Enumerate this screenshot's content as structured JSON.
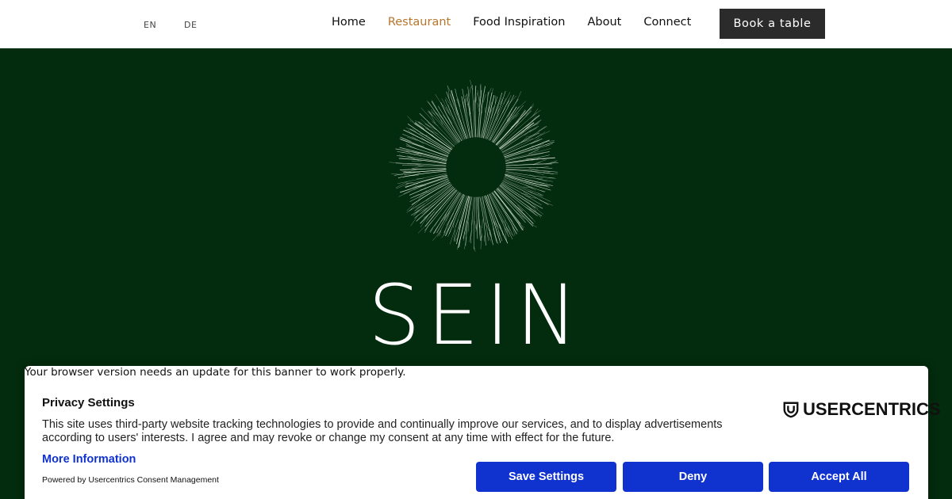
{
  "header": {
    "languages": [
      "EN",
      "DE"
    ],
    "nav": [
      "Home",
      "Restaurant",
      "Food Inspiration",
      "About",
      "Connect"
    ],
    "active_nav": "Restaurant",
    "book_label": "Book a table"
  },
  "hero": {
    "brand": "SEIN",
    "background": "#032b0d"
  },
  "consent": {
    "warning": "Your browser version needs an update for this banner to work properly.",
    "title": "Privacy Settings",
    "description": "This site uses third-party website tracking technologies to provide and continually improve our services, and to display advertisements according to users' interests. I agree and may revoke or change my consent at any time with effect for the future.",
    "more_info": "More Information",
    "powered_by": "Powered by Usercentrics Consent Management",
    "logo_text": "USERCENTRICS",
    "buttons": {
      "save": "Save Settings",
      "deny": "Deny",
      "accept": "Accept All"
    },
    "accent": "#1032cf"
  }
}
